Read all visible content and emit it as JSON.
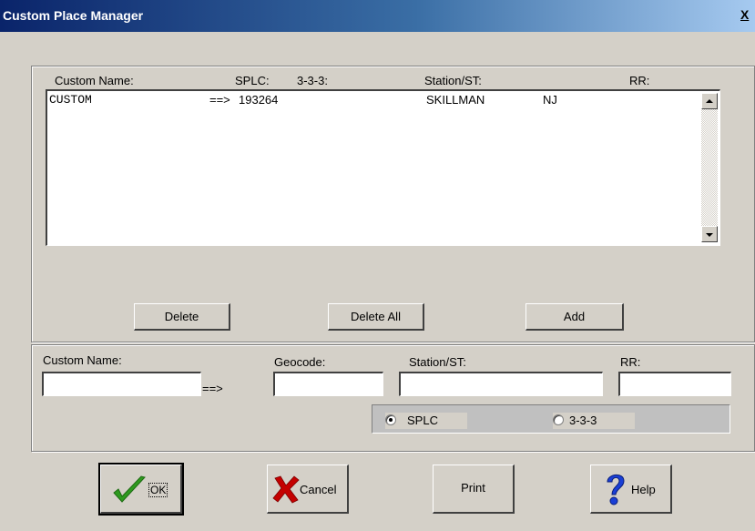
{
  "window": {
    "title": "Custom Place Manager",
    "close_glyph": "X"
  },
  "list": {
    "headers": {
      "name": "Custom Name:",
      "splc": "SPLC:",
      "code333": "3-3-3:",
      "station": "Station/ST:",
      "rr": "RR:"
    },
    "rows": [
      {
        "name": "CUSTOM",
        "arrow": "==>",
        "code": "193264",
        "station": "SKILLMAN",
        "state": "NJ"
      }
    ]
  },
  "list_buttons": {
    "delete": "Delete",
    "delete_all": "Delete All",
    "add": "Add"
  },
  "form": {
    "custom_name_label": "Custom Name:",
    "custom_name_value": "",
    "arrow": "==>",
    "geocode_label": "Geocode:",
    "geocode_value": "",
    "station_label": "Station/ST:",
    "station_value": "",
    "rr_label": "RR:",
    "rr_value": "",
    "radio_splc": "SPLC",
    "radio_333": "3-3-3",
    "selected_radio": "SPLC"
  },
  "footer": {
    "ok": "OK",
    "cancel": "Cancel",
    "print": "Print",
    "help": "Help"
  },
  "icons": {
    "ok": "checkmark-icon",
    "cancel": "x-icon",
    "help": "question-icon"
  },
  "colors": {
    "title_start": "#0a246a",
    "title_end": "#a6caf0",
    "check": "#2e9a1f",
    "cancel_x": "#c40000",
    "help_q": "#1a3fd6"
  }
}
